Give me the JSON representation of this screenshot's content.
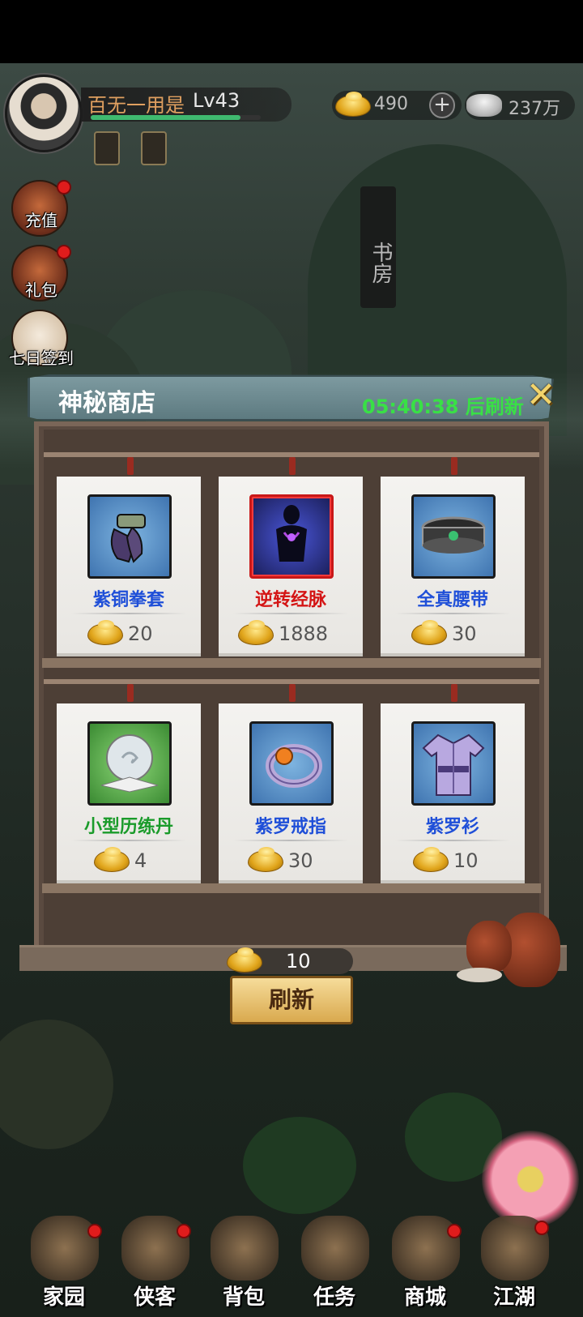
{
  "player": {
    "name": "百无一用是",
    "level": "Lv43",
    "exp_fraction": 0.88
  },
  "currency": {
    "gold": "490",
    "silver": "237万"
  },
  "side_menu": [
    {
      "label": "充值",
      "icon": "treasure-chest-icon"
    },
    {
      "label": "礼包",
      "icon": "gift-bag-icon"
    },
    {
      "label": "七日签到",
      "icon": "seven-day-icon"
    }
  ],
  "scene": {
    "sign": "书房"
  },
  "shop": {
    "title": "神秘商店",
    "timer": "05:40:38 后刷新",
    "items": [
      {
        "name": "紫铜拳套",
        "price": "20",
        "name_color": "#1f4fd8",
        "icon": "gauntlet-icon"
      },
      {
        "name": "逆转经脉",
        "price": "1888",
        "name_color": "#d41515",
        "icon": "meridian-skill-icon"
      },
      {
        "name": "全真腰带",
        "price": "30",
        "name_color": "#1f4fd8",
        "icon": "belt-icon"
      },
      {
        "name": "小型历练丹",
        "price": "4",
        "name_color": "#1a9b2a",
        "icon": "pill-orb-icon"
      },
      {
        "name": "紫罗戒指",
        "price": "30",
        "name_color": "#1f4fd8",
        "icon": "ring-icon"
      },
      {
        "name": "紫罗衫",
        "price": "10",
        "name_color": "#1f4fd8",
        "icon": "robe-icon"
      }
    ],
    "refresh_cost": "10",
    "refresh_label": "刷新"
  },
  "bottom_nav": [
    {
      "label": "家园",
      "badge": true
    },
    {
      "label": "侠客",
      "badge": true
    },
    {
      "label": "背包",
      "badge": false
    },
    {
      "label": "任务",
      "badge": false
    },
    {
      "label": "商城",
      "badge": true
    },
    {
      "label": "江湖",
      "badge": true
    }
  ],
  "colors": {
    "timer_green": "#39e046",
    "name_orange": "#e0a060",
    "badge_red": "#e01c1c"
  }
}
